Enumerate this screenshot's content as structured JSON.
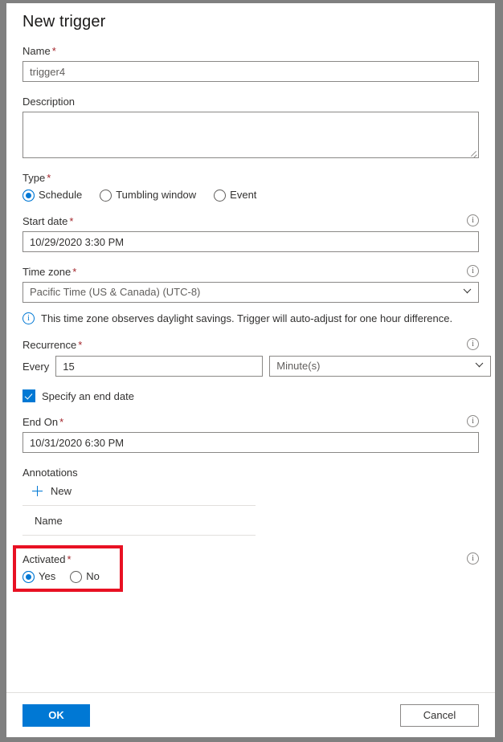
{
  "panel": {
    "title": "New trigger"
  },
  "name_field": {
    "label": "Name",
    "required": "*",
    "value": "trigger4"
  },
  "description_field": {
    "label": "Description",
    "value": ""
  },
  "type_field": {
    "label": "Type",
    "required": "*",
    "options": [
      {
        "label": "Schedule",
        "selected": true
      },
      {
        "label": "Tumbling window",
        "selected": false
      },
      {
        "label": "Event",
        "selected": false
      }
    ]
  },
  "start_date_field": {
    "label": "Start date",
    "required": "*",
    "value": "10/29/2020 3:30 PM",
    "info_icon": "info-icon"
  },
  "time_zone_field": {
    "label": "Time zone",
    "required": "*",
    "value": "Pacific Time (US & Canada) (UTC-8)",
    "info_icon": "info-icon",
    "chevron_icon": "chevron-down-icon"
  },
  "daylight_note": {
    "icon": "info-icon",
    "text": "This time zone observes daylight savings. Trigger will auto-adjust for one hour difference."
  },
  "recurrence_field": {
    "label": "Recurrence",
    "required": "*",
    "every_label": "Every",
    "value": "15",
    "unit": "Minute(s)",
    "info_icon": "info-icon",
    "chevron_icon": "chevron-down-icon"
  },
  "end_date_checkbox": {
    "label": "Specify an end date",
    "checked": true
  },
  "end_on_field": {
    "label": "End On",
    "required": "*",
    "value": "10/31/2020 6:30 PM",
    "info_icon": "info-icon"
  },
  "annotations": {
    "title": "Annotations",
    "new_label": "New",
    "plus_icon": "plus-icon",
    "column_header": "Name",
    "rows": []
  },
  "activated_field": {
    "label": "Activated",
    "required": "*",
    "info_icon": "info-icon",
    "options": [
      {
        "label": "Yes",
        "selected": true
      },
      {
        "label": "No",
        "selected": false
      }
    ],
    "highlight_color": "#e81123"
  },
  "footer": {
    "ok_label": "OK",
    "cancel_label": "Cancel"
  },
  "colors": {
    "accent": "#0078d4",
    "required_marker": "#a4262c",
    "highlight": "#e81123",
    "border": "#8a8886"
  }
}
